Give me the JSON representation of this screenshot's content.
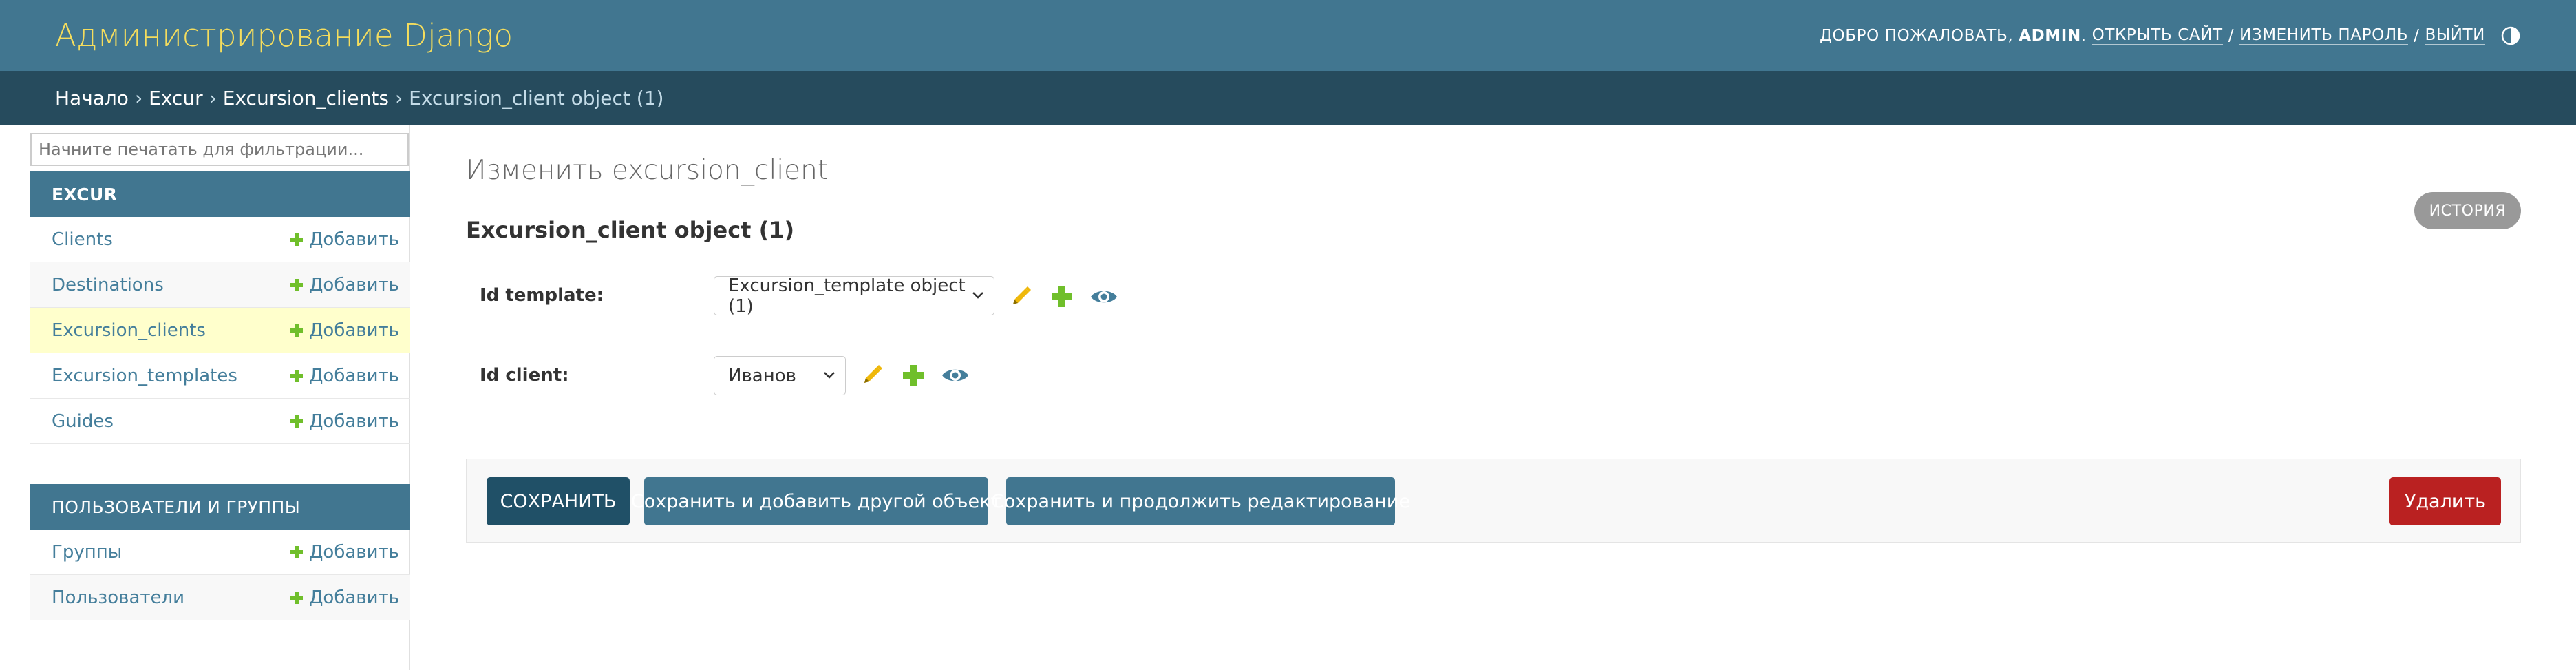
{
  "header": {
    "site_name": "Администрирование Django",
    "welcome": "Добро пожаловать,",
    "username": "admin",
    "view_site": "Открыть сайт",
    "change_password": "Изменить пароль",
    "logout": "Выйти",
    "separator": "/",
    "theme_icon": "theme-toggle-icon"
  },
  "breadcrumbs": {
    "items": [
      "Начало",
      "Excur",
      "Excursion_clients"
    ],
    "current": "Excursion_client object (1)",
    "separator": "›"
  },
  "sidebar": {
    "filter_placeholder": "Начните печатать для фильтрации...",
    "modules": [
      {
        "caption": "Excur",
        "rows": [
          {
            "label": "Clients",
            "add": "Добавить"
          },
          {
            "label": "Destinations",
            "add": "Добавить"
          },
          {
            "label": "Excursion_clients",
            "add": "Добавить",
            "current": true
          },
          {
            "label": "Excursion_templates",
            "add": "Добавить"
          },
          {
            "label": "Guides",
            "add": "Добавить"
          }
        ]
      },
      {
        "caption": "Пользователи и группы",
        "rows": [
          {
            "label": "Группы",
            "add": "Добавить"
          },
          {
            "label": "Пользователи",
            "add": "Добавить"
          }
        ]
      }
    ]
  },
  "content": {
    "page_title": "Изменить excursion_client",
    "object_title": "Excursion_client object (1)",
    "history_label": "История",
    "fields": [
      {
        "label": "Id template:",
        "value": "Excursion_template object (1)"
      },
      {
        "label": "Id client:",
        "value": "Иванов"
      }
    ]
  },
  "submit_row": {
    "save": "Сохранить",
    "save_add_another": "Сохранить и добавить другой объект",
    "save_continue": "Сохранить и продолжить редактирование",
    "delete": "Удалить"
  },
  "colors": {
    "header_bg": "#417690",
    "breadcrumbs_bg": "#264b5d",
    "branding": "#f5dd5d",
    "link": "#447e9b",
    "add_plus": "#70bf2b",
    "edit_pencil": "#efb80b",
    "view_eye": "#447e9b",
    "save_primary": "#205067",
    "delete": "#ba2121",
    "current_row": "#ffffcc"
  }
}
